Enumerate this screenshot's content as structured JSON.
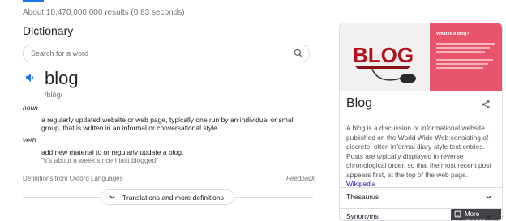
{
  "results_stats": "About 10,470,000,000 results (0.83 seconds)",
  "dictionary": {
    "heading": "Dictionary",
    "search_placeholder": "Search for a word",
    "word": "blog",
    "phonetic": "/blôg/",
    "entries": [
      {
        "pos": "noun",
        "definition": "a regularly updated website or web page, typically one run by an individual or small group, that is written in an informal or conversational style.",
        "example": ""
      },
      {
        "pos": "verb",
        "definition": "add new material to or regularly update a blog.",
        "example": "\"it's about a week since I last blogged\""
      }
    ],
    "source": "Definitions from Oxford Languages",
    "feedback": "Feedback",
    "more_button": "Translations and more definitions"
  },
  "knowledge_panel": {
    "image_right_title": "What is a blog?",
    "more_images": "More images",
    "title": "Blog",
    "description": "A blog is a discussion or informational website published on the World Wide Web consisting of discrete, often informal diary-style text entries. Posts are typically displayed in reverse chronological order, so that the most recent post appears first, at the top of the web page.",
    "source_link": "Wikipedia",
    "rows": [
      "Thesaurus",
      "Synonyms"
    ]
  },
  "colors": {
    "accent": "#1a73e8",
    "link": "#1a0dab",
    "pink_image": "#e8556b"
  }
}
